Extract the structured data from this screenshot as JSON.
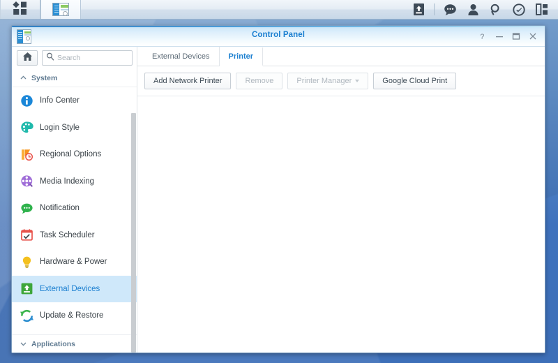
{
  "taskbar": {
    "left_buttons": [
      {
        "name": "app-menu-button",
        "icon": "grid-apps-icon",
        "label": ""
      },
      {
        "name": "taskbar-window-control-panel",
        "icon": "control-panel-window-icon",
        "label": "",
        "active": true
      }
    ],
    "right_icons": [
      {
        "name": "upload-queue-icon",
        "icon": "upload-icon"
      },
      {
        "name": "notifications-icon",
        "icon": "speech-bubble-icon"
      },
      {
        "name": "user-options-icon",
        "icon": "person-icon"
      },
      {
        "name": "search-icon",
        "icon": "magnifier-icon"
      },
      {
        "name": "pilot-view-icon",
        "icon": "check-circle-icon"
      },
      {
        "name": "widgets-icon",
        "icon": "widgets-panel-icon"
      }
    ]
  },
  "window": {
    "title": "Control Panel",
    "icon": "control-panel-window-icon",
    "controls": [
      {
        "name": "help-button",
        "label": "?",
        "icon": "question-mark-icon"
      },
      {
        "name": "minimize-button",
        "label": "–",
        "icon": "minimize-icon"
      },
      {
        "name": "maximize-button",
        "label": "□",
        "icon": "maximize-icon"
      },
      {
        "name": "close-button",
        "label": "×",
        "icon": "close-icon"
      }
    ]
  },
  "sidebar": {
    "home_button_icon": "home-icon",
    "search": {
      "placeholder": "Search",
      "value": ""
    },
    "group_system": {
      "label": "System",
      "expanded": true,
      "chevron": "chevron-up-icon"
    },
    "items": [
      {
        "label": "Info Center",
        "icon": "info-circle-icon",
        "color": "#1b87d8",
        "selected": false
      },
      {
        "label": "Login Style",
        "icon": "palette-icon",
        "color": "#1fb9ab",
        "selected": false
      },
      {
        "label": "Regional Options",
        "icon": "regional-clock-icon",
        "color": "#f5a623",
        "selected": false
      },
      {
        "label": "Media Indexing",
        "icon": "film-reel-icon",
        "color": "#a06ed8",
        "selected": false
      },
      {
        "label": "Notification",
        "icon": "speech-bubble-icon",
        "color": "#2fb24c",
        "selected": false
      },
      {
        "label": "Task Scheduler",
        "icon": "calendar-check-icon",
        "color": "#e8524b",
        "selected": false
      },
      {
        "label": "Hardware & Power",
        "icon": "lightbulb-icon",
        "color": "#f4c01e",
        "selected": false
      },
      {
        "label": "External Devices",
        "icon": "external-device-icon",
        "color": "#3ea63a",
        "selected": true
      },
      {
        "label": "Update & Restore",
        "icon": "refresh-arrows-icon",
        "color": "#2f8fd0",
        "selected": false
      }
    ],
    "group_applications": {
      "label": "Applications",
      "expanded": false,
      "chevron": "chevron-down-icon"
    }
  },
  "main": {
    "tabs": [
      {
        "label": "External Devices",
        "active": false
      },
      {
        "label": "Printer",
        "active": true
      }
    ],
    "toolbar": [
      {
        "label": "Add Network Printer",
        "disabled": false,
        "dropdown": false
      },
      {
        "label": "Remove",
        "disabled": true,
        "dropdown": false
      },
      {
        "label": "Printer Manager",
        "disabled": true,
        "dropdown": true
      },
      {
        "label": "Google Cloud Print",
        "disabled": false,
        "dropdown": false
      }
    ],
    "panel_content": ""
  },
  "colors": {
    "accent": "#1b7fd0",
    "selection": "#cfe8fa",
    "desktop": "#3f72bd",
    "text": "#3a4248"
  }
}
